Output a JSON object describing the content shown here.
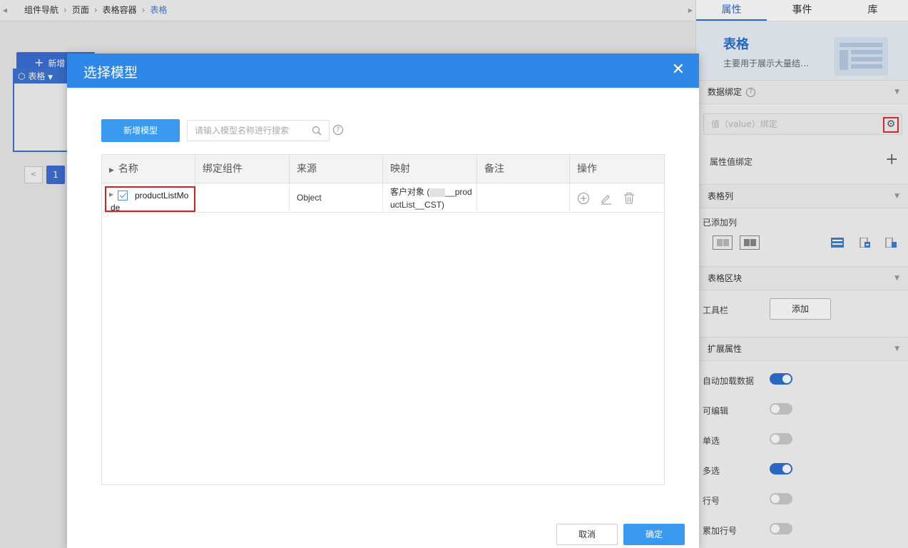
{
  "breadcrumb": {
    "items": [
      "组件导航",
      "页面",
      "表格容器"
    ],
    "current": "表格"
  },
  "canvas": {
    "add_label": "新增",
    "table_tag": "表格",
    "pager_current": "1"
  },
  "right_panel": {
    "tabs": [
      "属性",
      "事件",
      "库"
    ],
    "active_tab": "属性",
    "component_title": "表格",
    "component_desc": "主要用于展示大量结…",
    "sections": {
      "data_binding": "数据绑定",
      "table_columns": "表格列",
      "table_blocks": "表格区块",
      "extended_props": "扩展属性"
    },
    "value_binding_placeholder": "值（value）绑定",
    "property_binding_label": "属性值绑定",
    "added_columns_label": "已添加列",
    "toolbar_label": "工具栏",
    "toolbar_add": "添加",
    "toggles": [
      {
        "label": "自动加载数据",
        "on": true
      },
      {
        "label": "可编辑",
        "on": false
      },
      {
        "label": "单选",
        "on": false
      },
      {
        "label": "多选",
        "on": true
      },
      {
        "label": "行号",
        "on": false
      },
      {
        "label": "累加行号",
        "on": false
      }
    ]
  },
  "modal": {
    "title": "选择模型",
    "add_model_label": "新增模型",
    "search_placeholder": "请输入模型名称进行搜索",
    "columns": [
      "名称",
      "绑定组件",
      "来源",
      "映射",
      "备注",
      "操作"
    ],
    "rows": [
      {
        "name": "productListMode",
        "bound": "",
        "source": "Object",
        "mapping_line1": "客户对象 (",
        "mapping_line1b": "__prod",
        "mapping_line2": "uctList__CST)",
        "remark": ""
      }
    ],
    "cancel_label": "取消",
    "confirm_label": "确定"
  },
  "colors": {
    "header_blue": "#2f88e8",
    "primary_button": "#3a9af0",
    "highlight_red": "#d42020",
    "accent_blue": "#2f6fd1"
  }
}
